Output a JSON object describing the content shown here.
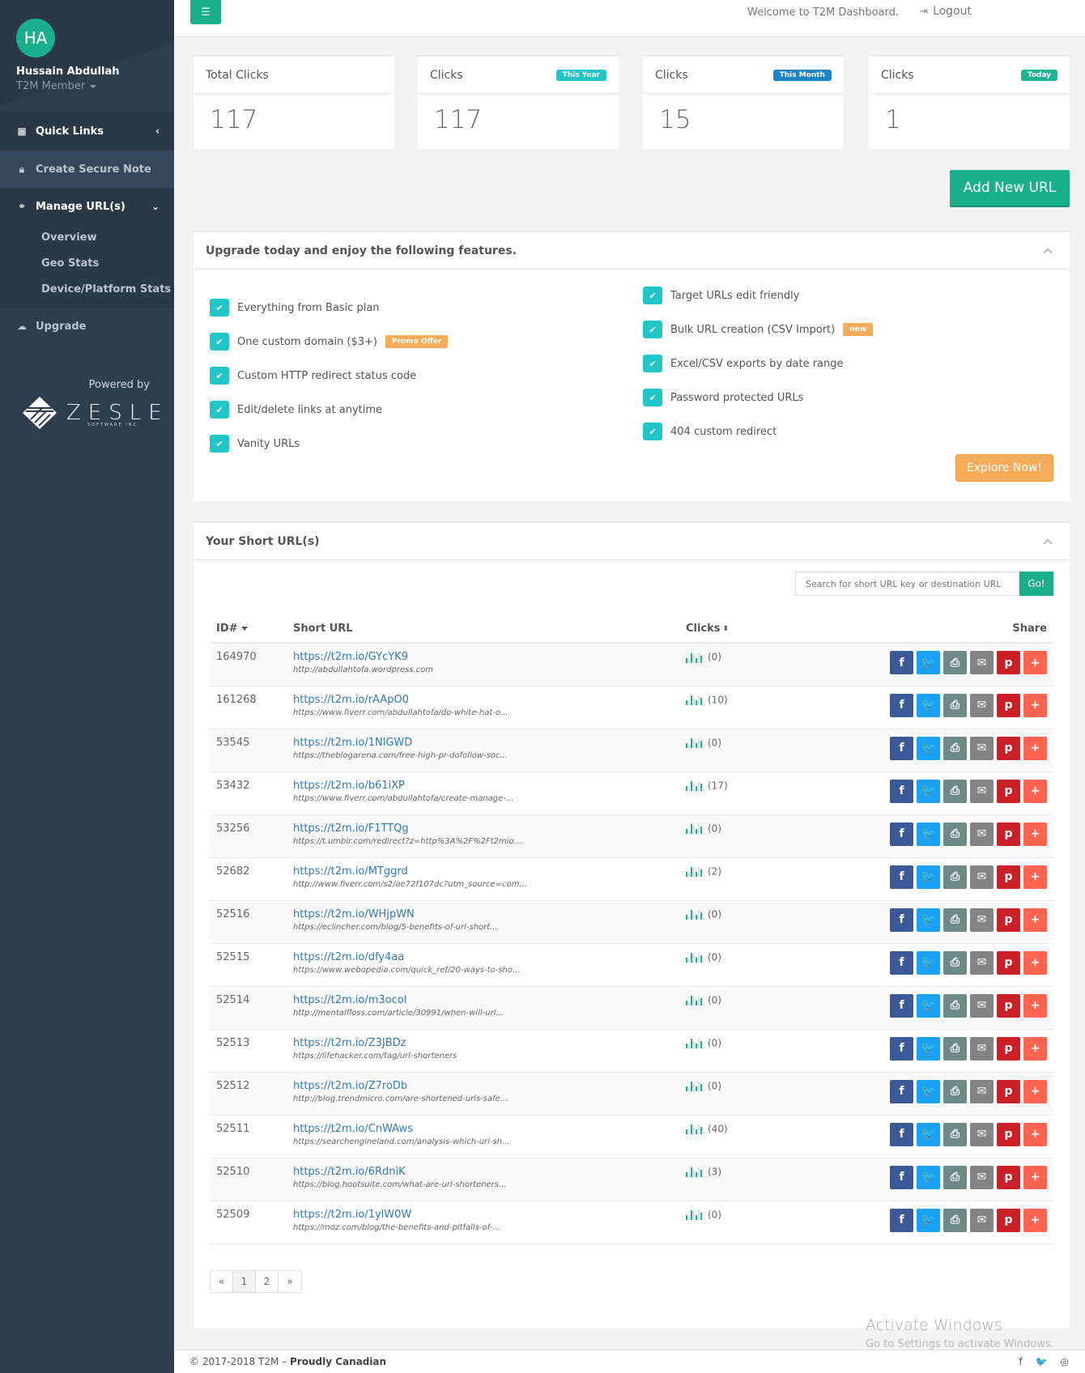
{
  "sidebar": {
    "avatar_initials": "HA",
    "user_name": "Hussain Abdullah",
    "user_role": "T2M Member",
    "nav": {
      "quick_links": "Quick Links",
      "create_secure_note": "Create Secure Note",
      "manage_urls": "Manage URL(s)",
      "sub_items": [
        "Overview",
        "Geo Stats",
        "Device/Platform Stats"
      ],
      "upgrade": "Upgrade"
    },
    "powered_by": "Powered by",
    "brand_name": "ZESLE",
    "brand_sub": "SOFTWARE INC."
  },
  "topbar": {
    "welcome": "Welcome to T2M Dashboard.",
    "logout": "Logout"
  },
  "stats": [
    {
      "label": "Total Clicks",
      "badge": "",
      "value": "117"
    },
    {
      "label": "Clicks",
      "badge": "This Year",
      "badge_color": "#23c6c8",
      "value": "117"
    },
    {
      "label": "Clicks",
      "badge": "This Month",
      "badge_color": "#1c84c6",
      "value": "15"
    },
    {
      "label": "Clicks",
      "badge": "Today",
      "badge_color": "#1ab394",
      "value": "1"
    }
  ],
  "add_url_button": "Add New URL",
  "upgrade_panel": {
    "title": "Upgrade today and enjoy the following features.",
    "left_features": [
      {
        "text": "Everything from Basic plan",
        "badge": ""
      },
      {
        "text": "One custom domain ($3+)",
        "badge": "Promo Offer"
      },
      {
        "text": "Custom HTTP redirect status code",
        "badge": ""
      },
      {
        "text": "Edit/delete links at anytime",
        "badge": ""
      },
      {
        "text": "Vanity URLs",
        "badge": ""
      }
    ],
    "right_features": [
      {
        "text": "Target URLs edit friendly",
        "badge": ""
      },
      {
        "text": "Bulk URL creation (CSV Import)",
        "badge": "new"
      },
      {
        "text": "Excel/CSV exports by date range",
        "badge": ""
      },
      {
        "text": "Password protected URLs",
        "badge": ""
      },
      {
        "text": "404 custom redirect",
        "badge": ""
      }
    ],
    "explore_button": "Explore Now!"
  },
  "urls_panel": {
    "title": "Your Short URL(s)",
    "search_placeholder": "Search for short URL key or destination URL",
    "search_button": "Go!",
    "columns": {
      "id": "ID#",
      "short_url": "Short URL",
      "clicks": "Clicks",
      "share": "Share"
    },
    "rows": [
      {
        "id": "164970",
        "short": "https://t2m.io/GYcYK9",
        "dest": "http://abdullahtofa.wordpress.com",
        "clicks": "(0)"
      },
      {
        "id": "161268",
        "short": "https://t2m.io/rAApO0",
        "dest": "https://www.fiverr.com/abdullahtofa/do-white-hat-o...",
        "clicks": "(10)"
      },
      {
        "id": "53545",
        "short": "https://t2m.io/1NlGWD",
        "dest": "https://theblogarena.com/free-high-pr-dofollow-soc...",
        "clicks": "(0)"
      },
      {
        "id": "53432",
        "short": "https://t2m.io/b61iXP",
        "dest": "https://www.fiverr.com/abdullahtofa/create-manage-...",
        "clicks": "(17)"
      },
      {
        "id": "53256",
        "short": "https://t2m.io/F1TTQg",
        "dest": "https://t.umblr.com/redirect?z=http%3A%2F%2Ft2mio....",
        "clicks": "(0)"
      },
      {
        "id": "52682",
        "short": "https://t2m.io/MTggrd",
        "dest": "http://www.fiverr.com/s2/ae72f107dc?utm_source=com...",
        "clicks": "(2)"
      },
      {
        "id": "52516",
        "short": "https://t2m.io/WHjpWN",
        "dest": "https://eclincher.com/blog/5-benefits-of-url-short...",
        "clicks": "(0)"
      },
      {
        "id": "52515",
        "short": "https://t2m.io/dfy4aa",
        "dest": "https://www.webopedia.com/quick_ref/20-ways-to-sho...",
        "clicks": "(0)"
      },
      {
        "id": "52514",
        "short": "https://t2m.io/m3ocol",
        "dest": "http://mentalfloss.com/article/30991/when-will-url...",
        "clicks": "(0)"
      },
      {
        "id": "52513",
        "short": "https://t2m.io/Z3JBDz",
        "dest": "https://lifehacker.com/tag/url-shorteners",
        "clicks": "(0)"
      },
      {
        "id": "52512",
        "short": "https://t2m.io/Z7roDb",
        "dest": "http://blog.trendmicro.com/are-shortened-urls-safe...",
        "clicks": "(0)"
      },
      {
        "id": "52511",
        "short": "https://t2m.io/CnWAws",
        "dest": "https://searchengineland.com/analysis-which-url-sh...",
        "clicks": "(40)"
      },
      {
        "id": "52510",
        "short": "https://t2m.io/6RdniK",
        "dest": "https://blog.hootsuite.com/what-are-url-shorteners...",
        "clicks": "(3)"
      },
      {
        "id": "52509",
        "short": "https://t2m.io/1ylW0W",
        "dest": "https://moz.com/blog/the-benefits-and-pitfalls-of-...",
        "clicks": "(0)"
      }
    ],
    "share_buttons": [
      {
        "name": "facebook",
        "glyph": "f",
        "color": "#3b5998"
      },
      {
        "name": "twitter",
        "glyph": "🐦",
        "color": "#1da1f2"
      },
      {
        "name": "print",
        "glyph": "⎙",
        "color": "#6d8a89"
      },
      {
        "name": "email",
        "glyph": "✉",
        "color": "#848484"
      },
      {
        "name": "pinterest",
        "glyph": "p",
        "color": "#cb2027"
      },
      {
        "name": "more",
        "glyph": "+",
        "color": "#ff6550"
      }
    ],
    "pagination": [
      "«",
      "1",
      "2",
      "»"
    ]
  },
  "watermark": {
    "line1": "Activate Windows",
    "line2": "Go to Settings to activate Windows."
  },
  "footer": {
    "copyright": "© 2017-2018 T2M – ",
    "tagline": "Proudly Canadian",
    "social": [
      "f",
      "🐦",
      "◎"
    ]
  }
}
